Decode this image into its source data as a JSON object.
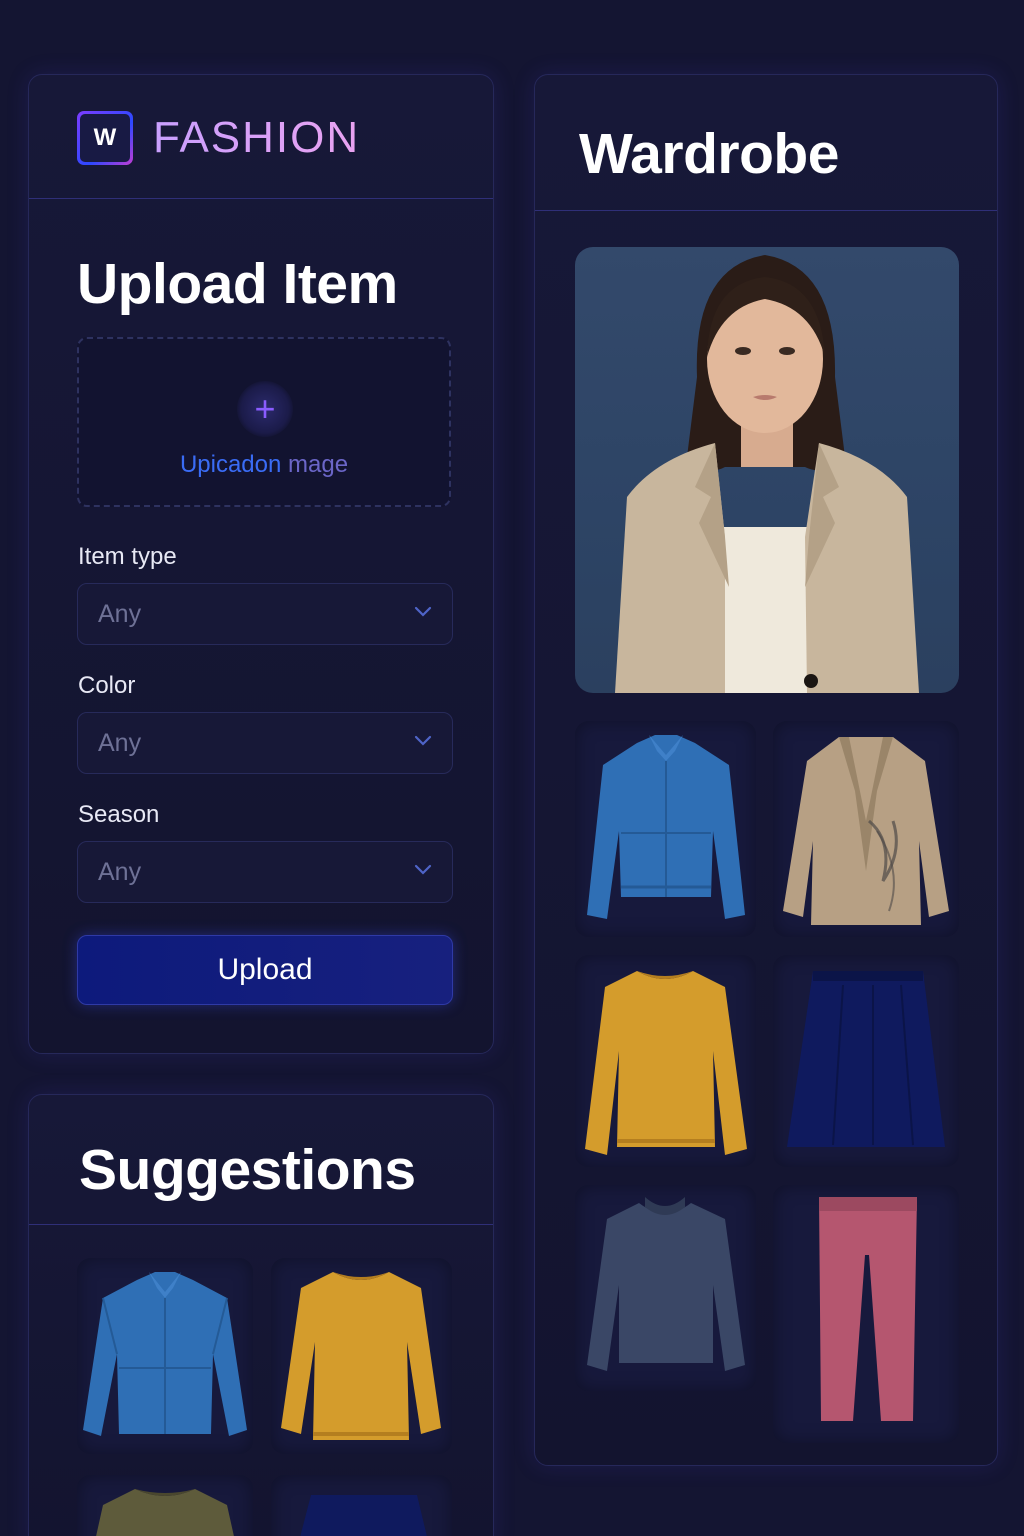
{
  "brand": {
    "logo_letter": "W",
    "name": "FASHION"
  },
  "upload": {
    "title": "Upload Item",
    "dropzone_text_a": "Upicadon",
    "dropzone_text_b": " mage",
    "fields": [
      {
        "label": "Item type",
        "value": "Any"
      },
      {
        "label": "Color",
        "value": "Any"
      },
      {
        "label": "Season",
        "value": "Any"
      }
    ],
    "button_label": "Upload"
  },
  "suggestions": {
    "title": "Suggestions",
    "items": [
      {
        "kind": "denim-jacket",
        "color": "#2f6fb5"
      },
      {
        "kind": "sweater",
        "color": "#d49c2c"
      },
      {
        "kind": "sweater",
        "color": "#5e5b3b"
      },
      {
        "kind": "skirt",
        "color": "#0f1a5e"
      }
    ]
  },
  "wardrobe": {
    "title": "Wardrobe",
    "items": [
      {
        "kind": "denim-jacket",
        "color": "#2f6fb5"
      },
      {
        "kind": "blazer",
        "color": "#b7a084"
      },
      {
        "kind": "sweater",
        "color": "#d49c2c"
      },
      {
        "kind": "skirt",
        "color": "#0f1a5e"
      },
      {
        "kind": "sweater",
        "color": "#3a4766"
      },
      {
        "kind": "pants",
        "color": "#b5566f"
      }
    ]
  },
  "colors": {
    "accent": "#3a6cf5",
    "brand_gradient_a": "#c9a0ff",
    "brand_gradient_b": "#e9a2f0",
    "button": "#0d1a7c"
  }
}
